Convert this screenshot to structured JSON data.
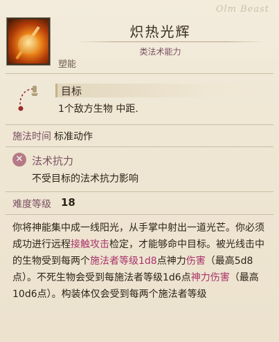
{
  "watermark": "Olm Beast",
  "spell": {
    "name": "炽热光辉",
    "type": "类法术能力",
    "school": "塑能",
    "portrait_icon": "radiant-hand-icon"
  },
  "target": {
    "label": "目标",
    "value": "1个敌方生物 中距."
  },
  "casting_time": {
    "label": "施法时间",
    "value": "标准动作"
  },
  "spell_resistance": {
    "label": "法术抗力",
    "description": "不受目标的法术抗力影响",
    "icon": "no-resist-icon"
  },
  "difficulty": {
    "label": "难度等级",
    "value": "18"
  },
  "description": {
    "p1": "你将神能集中成一线阳光，从手掌中射出一道光芒。你必须成功进行远程",
    "link1": "接触攻击",
    "p2": "检定，才能够命中目标。被光线击中的生物受到每两个",
    "link2": "施法者等级1d8",
    "p3": "点神力",
    "link3": "伤害",
    "p4": "（最高5d8点）。不死生物会受到每施法者等级1d6点",
    "link4": "神力伤害",
    "p5": "（最高10d6点）。构装体仅会受到每两个施法者等级"
  },
  "colors": {
    "accent": "#7a4f63",
    "link": "#a8336a",
    "background": "#efe7d6"
  }
}
